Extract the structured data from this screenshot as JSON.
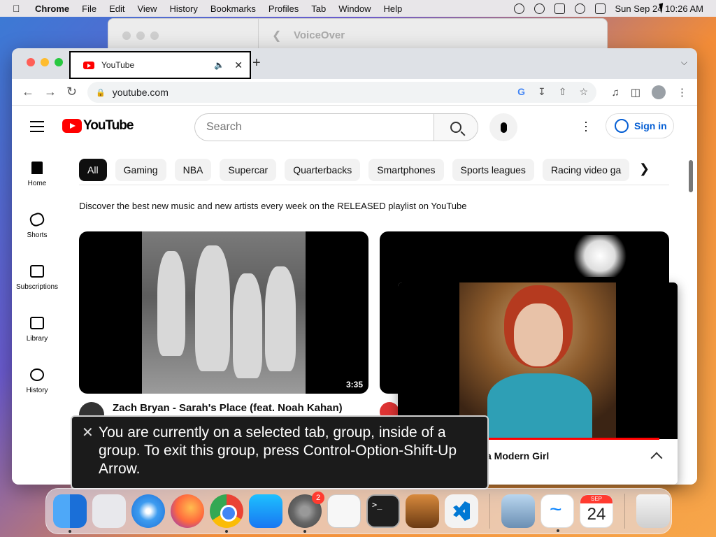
{
  "menubar": {
    "app_name": "Chrome",
    "items": [
      "File",
      "Edit",
      "View",
      "History",
      "Bookmarks",
      "Profiles",
      "Tab",
      "Window",
      "Help"
    ],
    "clock": "Sun Sep 24  10:26 AM"
  },
  "background_window": {
    "title": "VoiceOver"
  },
  "chrome": {
    "tab_title": "YouTube",
    "url": "youtube.com"
  },
  "youtube": {
    "logo_text": "YouTube",
    "search_placeholder": "Search",
    "sign_in": "Sign in",
    "sidebar": [
      "Home",
      "Shorts",
      "Subscriptions",
      "Library",
      "History"
    ],
    "chips": [
      "All",
      "Gaming",
      "NBA",
      "Supercar",
      "Quarterbacks",
      "Smartphones",
      "Sports leagues",
      "Racing video ga"
    ],
    "banner": "Discover the best new music and new artists every week on the RELEASED playlist on YouTube",
    "video1": {
      "title": "Zach Bryan - Sarah's Place (feat. Noah Kahan)",
      "duration": "3:35"
    },
    "pip": {
      "label": "a Modern Girl"
    }
  },
  "voiceover_caption": "You are currently on a selected tab, group, inside of a group.  To exit this group, press Control-Option-Shift-Up Arrow.",
  "dock": {
    "settings_badge": "2",
    "calendar_month": "SEP",
    "calendar_day": "24"
  }
}
